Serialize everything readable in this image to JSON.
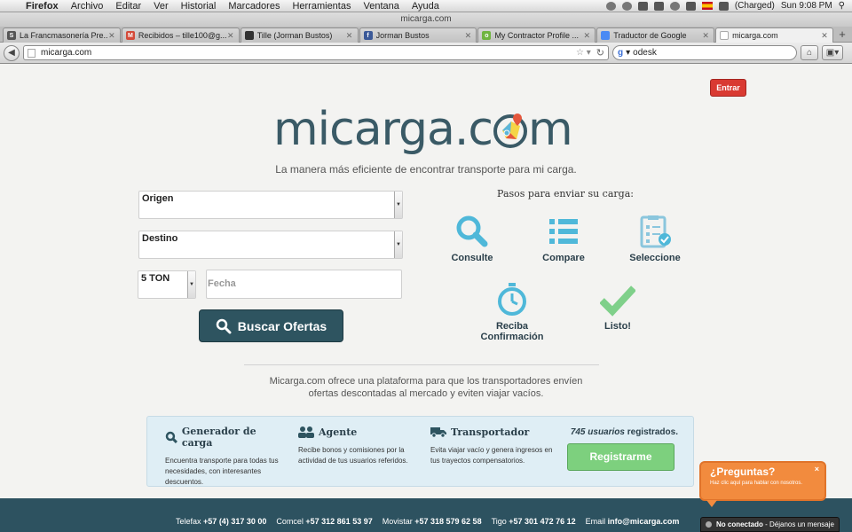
{
  "menubar": {
    "app": "Firefox",
    "items": [
      "Archivo",
      "Editar",
      "Ver",
      "Historial",
      "Marcadores",
      "Herramientas",
      "Ventana",
      "Ayuda"
    ],
    "battery": "(Charged)",
    "clock": "Sun 9:08 PM"
  },
  "window": {
    "title": "micarga.com"
  },
  "tabs": [
    {
      "label": "La Francmasonería Pre...",
      "favicon_color": "#555555",
      "favicon_text": "S"
    },
    {
      "label": "Recibidos – tille100@g...",
      "favicon_color": "#d44b3a",
      "favicon_text": "M"
    },
    {
      "label": "Tille (Jorman Bustos)",
      "favicon_color": "#333333",
      "favicon_text": ""
    },
    {
      "label": "Jorman Bustos",
      "favicon_color": "#3b5998",
      "favicon_text": "f"
    },
    {
      "label": "My Contractor Profile ...",
      "favicon_color": "#6fb43f",
      "favicon_text": "o"
    },
    {
      "label": "Traductor de Google",
      "favicon_color": "#4a8af4",
      "favicon_text": ""
    },
    {
      "label": "micarga.com",
      "favicon_color": "#ffffff",
      "favicon_text": ""
    }
  ],
  "nav": {
    "url": "micarga.com",
    "search_value": "odesk"
  },
  "page": {
    "login_label": "Entrar",
    "logo_before": "micarga.c",
    "logo_after": "m",
    "tagline": "La manera más eficiente de encontrar transporte para mi carga.",
    "form": {
      "origen": "Origen",
      "destino": "Destino",
      "ton": "5 TON",
      "fecha_placeholder": "Fecha",
      "search_label": "Buscar Ofertas"
    },
    "steps_title": "Pasos para enviar su carga:",
    "steps": [
      {
        "label": "Consulte",
        "icon": "magnifier-icon"
      },
      {
        "label": "Compare",
        "icon": "list-icon"
      },
      {
        "label": "Seleccione",
        "icon": "clipboard-check-icon"
      },
      {
        "label": "Reciba Confirmación",
        "icon": "stopwatch-icon"
      },
      {
        "label": "Listo!",
        "icon": "checkmark-icon"
      }
    ],
    "description": "Micarga.com ofrece una plataforma para que los transportadores envíen ofertas descontadas al mercado y eviten viajar vacíos.",
    "columns": [
      {
        "title": "Generador de carga",
        "text": "Encuentra transporte para todas tus necesidades, con interesantes descuentos."
      },
      {
        "title": "Agente",
        "text": "Recibe bonos y comisiones por la actividad de tus usuarios referidos."
      },
      {
        "title": "Transportador",
        "text": "Evita viajar vacío y genera ingresos en tus trayectos compensatorios."
      }
    ],
    "registered_count": "745 usuarios",
    "registered_suffix": " registrados.",
    "register_label": "Registrarme",
    "footer": [
      {
        "label": "Telefax",
        "value": "+57 (4) 317 30 00"
      },
      {
        "label": "Comcel",
        "value": "+57 312 861 53 97"
      },
      {
        "label": "Movistar",
        "value": "+57 318 579 62 58"
      },
      {
        "label": "Tigo",
        "value": "+57 301 472 76 12"
      },
      {
        "label": "Email",
        "value": "info@micarga.com"
      }
    ],
    "chat": {
      "title": "¿Preguntas?",
      "subtitle": "Haz clic aquí para hablar con nosotros.",
      "close": "×",
      "status": "No conectado",
      "status_suffix": " - Déjanos un mensaje"
    }
  },
  "colors": {
    "accent": "#2e5460",
    "icon_blue": "#4fb8d9",
    "check_green": "#7fd08a",
    "register_green": "#7dd07e",
    "login_red": "#d93a32",
    "chat_orange": "#f28b3e"
  }
}
